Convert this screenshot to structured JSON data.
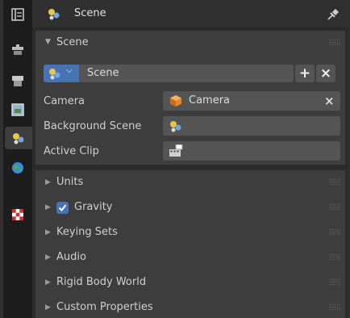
{
  "header": {
    "context_label": "Scene"
  },
  "scene_panel": {
    "title": "Scene",
    "datablock": {
      "name": "Scene",
      "add_symbol": "+",
      "remove_symbol": "×"
    },
    "camera": {
      "label": "Camera",
      "value": "Camera",
      "clear_symbol": "×"
    },
    "background_scene": {
      "label": "Background Scene",
      "value": ""
    },
    "active_clip": {
      "label": "Active Clip",
      "value": ""
    }
  },
  "panels": [
    {
      "label": "Units"
    },
    {
      "label": "Gravity",
      "checked": true
    },
    {
      "label": "Keying Sets"
    },
    {
      "label": "Audio"
    },
    {
      "label": "Rigid Body World"
    },
    {
      "label": "Custom Properties"
    }
  ],
  "icons": {
    "tool": "tool-icon",
    "render": "render-icon",
    "output": "output-icon",
    "view_layer": "view-layer-icon",
    "scene": "scene-icon",
    "world": "world-icon",
    "texture": "texture-icon",
    "pin": "pin-icon",
    "camera": "camera-object-icon",
    "clip": "movie-clip-icon"
  },
  "colors": {
    "accent": "#4772b3",
    "camera_orange": "#e8862b"
  }
}
